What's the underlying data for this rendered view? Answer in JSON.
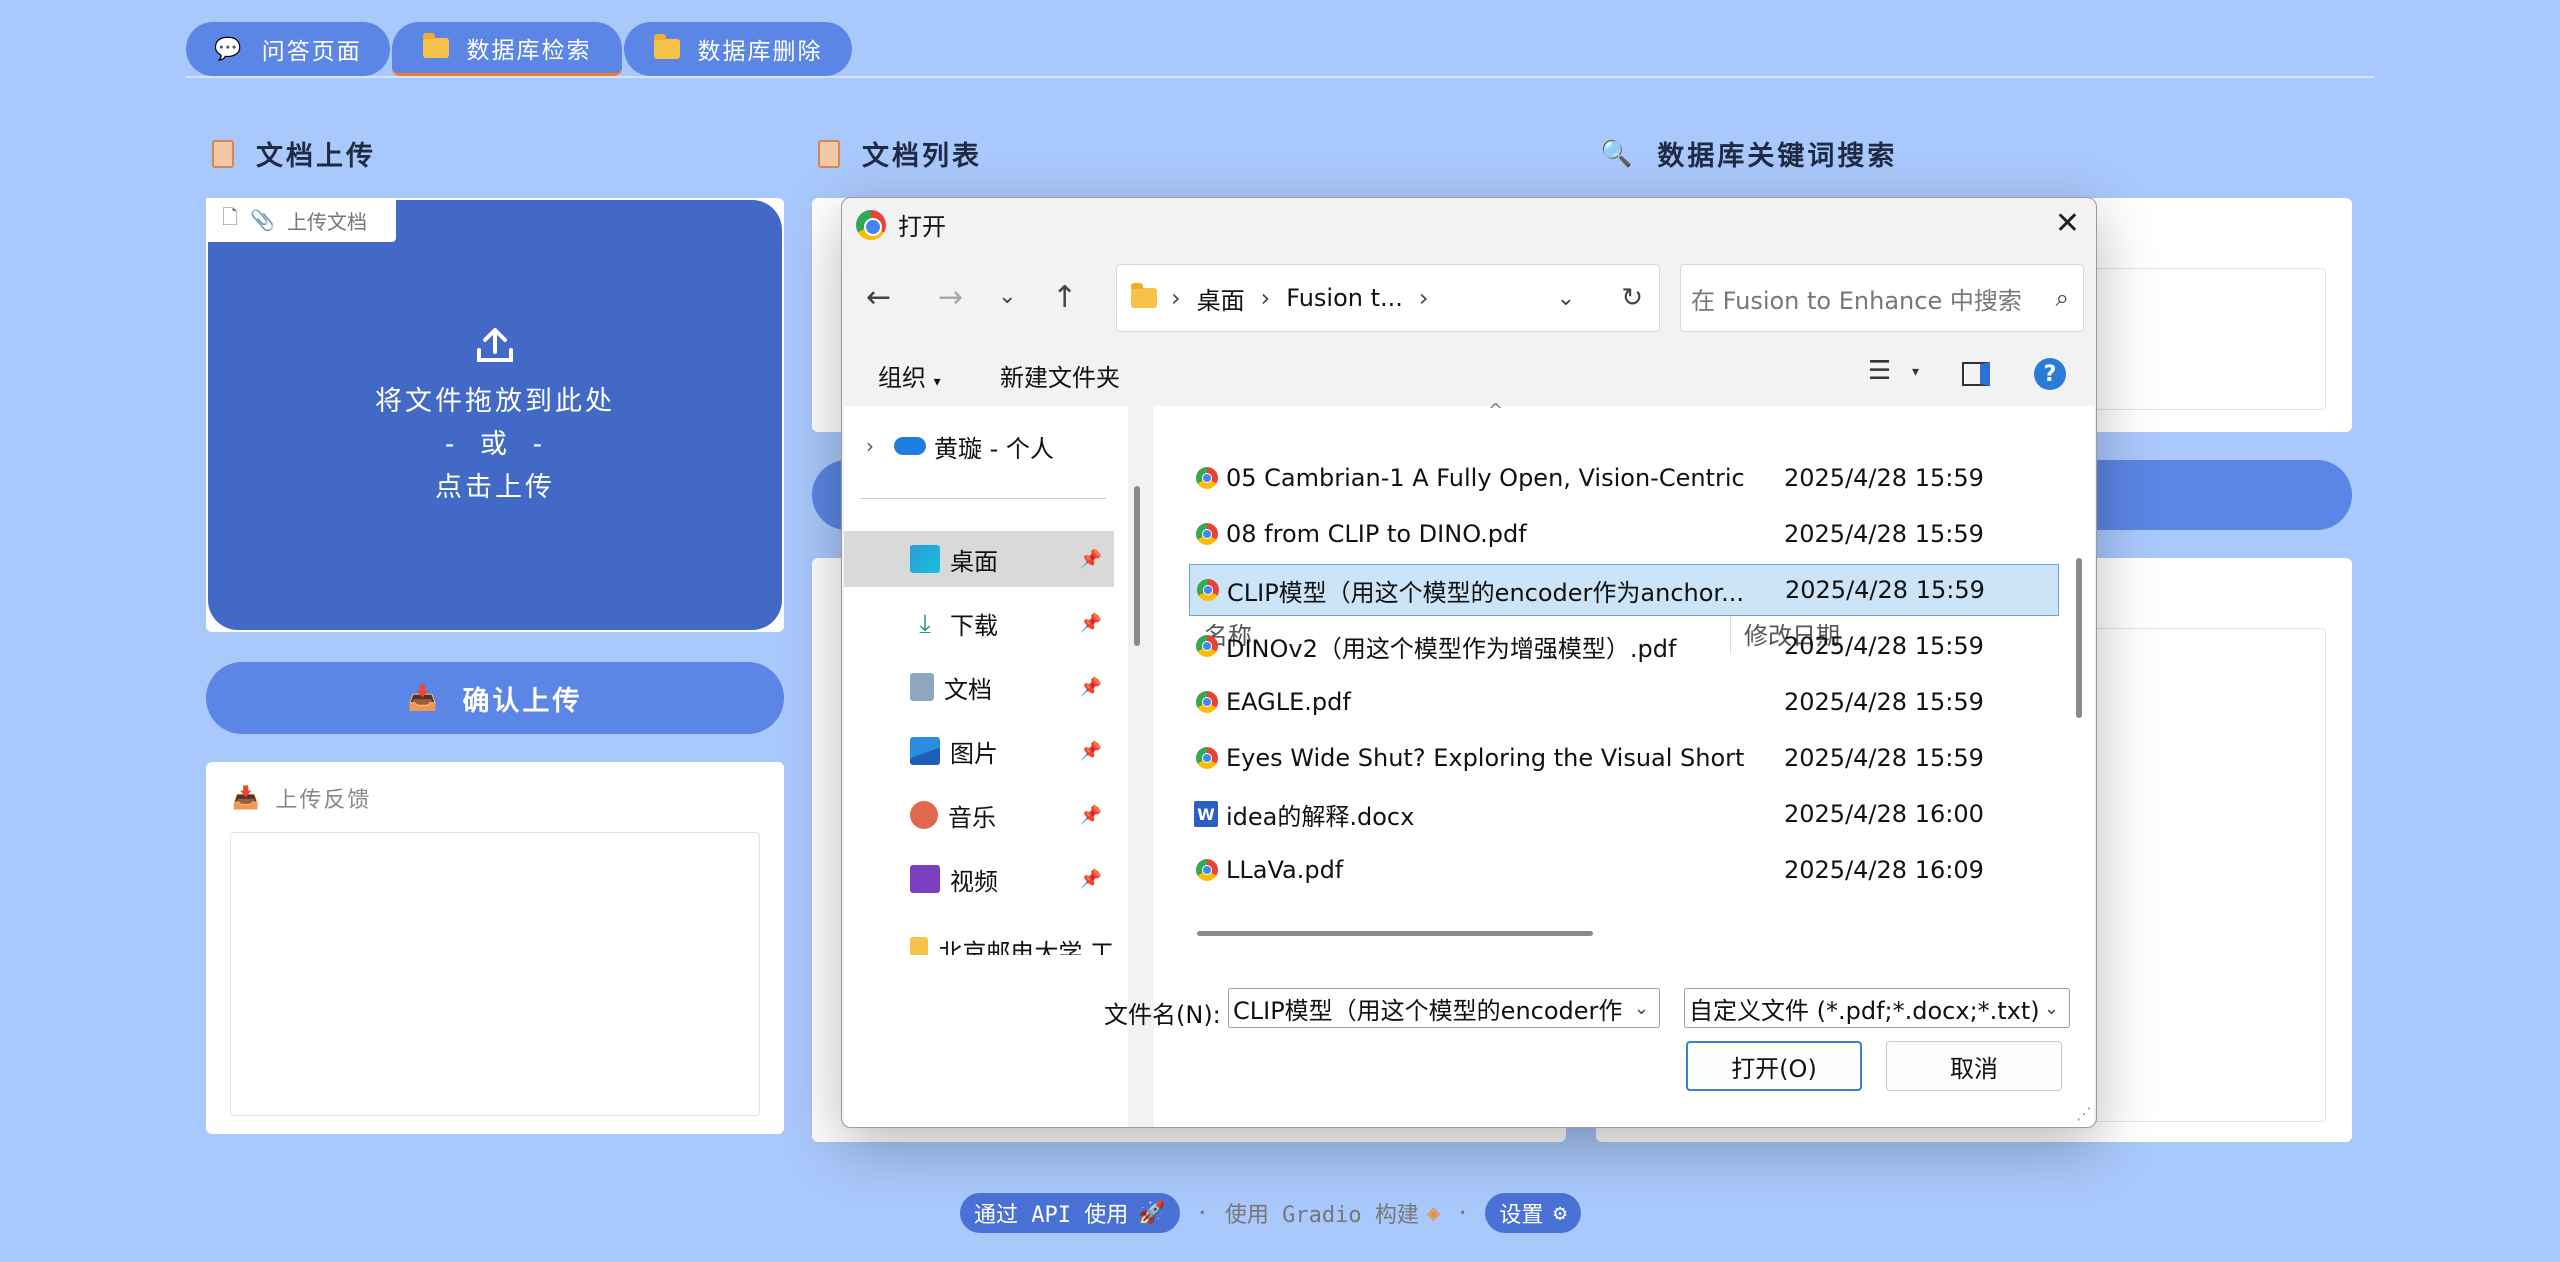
{
  "tabs": [
    {
      "label": "问答页面",
      "icon": "speech-bubble-icon"
    },
    {
      "label": "数据库检索",
      "icon": "folder-icon",
      "active": true
    },
    {
      "label": "数据库删除",
      "icon": "folder-icon"
    }
  ],
  "sections": {
    "upload_title": "文档上传",
    "list_title": "文档列表",
    "search_title": "数据库关键词搜索"
  },
  "upload": {
    "tag_label": "上传文档",
    "drop_line1": "将文件拖放到此处",
    "drop_line2": "- 或 -",
    "drop_line3": "点击上传",
    "confirm_label": "确认上传",
    "feedback_label": "上传反馈"
  },
  "footer": {
    "api_label": "通过 API 使用",
    "built_label": "使用 Gradio 构建",
    "settings_label": "设置",
    "separator": "·"
  },
  "dialog": {
    "title": "打开",
    "breadcrumb": [
      "桌面",
      "Fusion t..."
    ],
    "search_placeholder": "在 Fusion to Enhance 中搜索",
    "organize_label": "组织",
    "new_folder_label": "新建文件夹",
    "nav_items": [
      {
        "label": "黄璇 - 个人",
        "icon": "onedrive-icon"
      },
      {
        "label": "桌面",
        "icon": "desktop-icon",
        "selected": true
      },
      {
        "label": "下载",
        "icon": "download-icon"
      },
      {
        "label": "文档",
        "icon": "documents-icon"
      },
      {
        "label": "图片",
        "icon": "pictures-icon"
      },
      {
        "label": "音乐",
        "icon": "music-icon"
      },
      {
        "label": "视频",
        "icon": "video-icon"
      },
      {
        "label": "北京邮电大学 工",
        "icon": "folder-icon"
      }
    ],
    "columns": {
      "name": "名称",
      "date": "修改日期"
    },
    "files": [
      {
        "name": "05 Cambrian-1 A Fully Open, Vision-Centric....",
        "date": "2025/4/28 15:59",
        "type": "pdf"
      },
      {
        "name": "08 from CLIP to DINO.pdf",
        "date": "2025/4/28 15:59",
        "type": "pdf"
      },
      {
        "name": "CLIP模型（用这个模型的encoder作为anchor...",
        "date": "2025/4/28 15:59",
        "type": "pdf",
        "selected": true
      },
      {
        "name": "DINOv2（用这个模型作为增强模型）.pdf",
        "date": "2025/4/28 15:59",
        "type": "pdf"
      },
      {
        "name": "EAGLE.pdf",
        "date": "2025/4/28 15:59",
        "type": "pdf"
      },
      {
        "name": "Eyes Wide Shut?  Exploring the Visual Short...",
        "date": "2025/4/28 15:59",
        "type": "pdf"
      },
      {
        "name": "idea的解释.docx",
        "date": "2025/4/28 16:00",
        "type": "docx"
      },
      {
        "name": "LLaVa.pdf",
        "date": "2025/4/28 16:09",
        "type": "pdf"
      }
    ],
    "filename_label": "文件名(N):",
    "filename_value": "CLIP模型（用这个模型的encoder作为anchor",
    "filter_value": "自定义文件 (*.pdf;*.docx;*.txt)",
    "open_label": "打开(O)",
    "cancel_label": "取消"
  }
}
